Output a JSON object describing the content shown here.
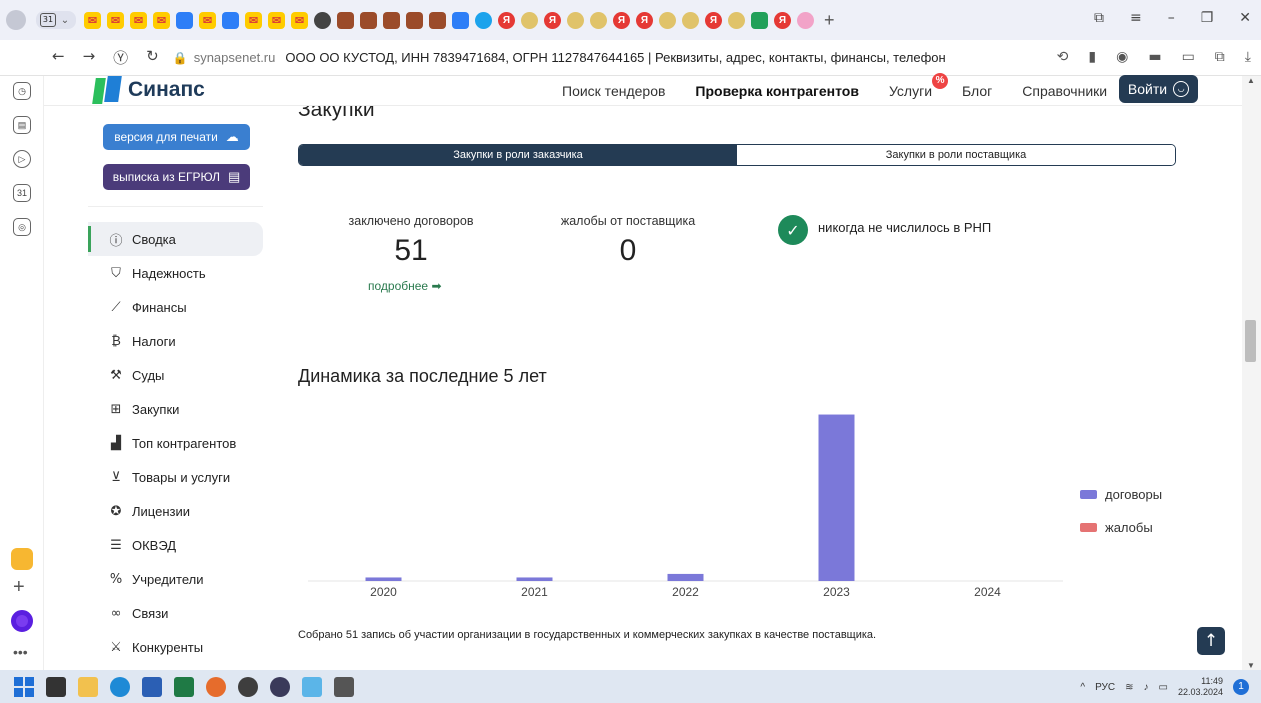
{
  "browser": {
    "calendar_badge": "31",
    "address": {
      "domain": "synapsenet.ru",
      "page_title": "ООО ОО КУСТОД, ИНН 7839471684, ОГРН 1127847644165 | Реквизиты, адрес, контакты, финансы, телефон и..."
    }
  },
  "header": {
    "logo_text": "Синапс",
    "nav": [
      {
        "label": "Поиск тендеров"
      },
      {
        "label": "Проверка контрагентов"
      },
      {
        "label": "Услуги"
      },
      {
        "label": "Блог"
      },
      {
        "label": "Справочники"
      }
    ],
    "services_badge": "%",
    "login_label": "Войти"
  },
  "sidebar": {
    "print_button": "версия для печати",
    "egrul_button": "выписка из ЕГРЮЛ",
    "items": [
      {
        "label": "Сводка",
        "icon": "info-icon"
      },
      {
        "label": "Надежность",
        "icon": "shield-icon"
      },
      {
        "label": "Финансы",
        "icon": "chart-line-icon"
      },
      {
        "label": "Налоги",
        "icon": "tax-icon"
      },
      {
        "label": "Суды",
        "icon": "gavel-icon"
      },
      {
        "label": "Закупки",
        "icon": "briefcase-icon"
      },
      {
        "label": "Топ контрагентов",
        "icon": "podium-icon"
      },
      {
        "label": "Товары и услуги",
        "icon": "cart-icon"
      },
      {
        "label": "Лицензии",
        "icon": "medal-icon"
      },
      {
        "label": "ОКВЭД",
        "icon": "list-icon"
      },
      {
        "label": "Учредители",
        "icon": "percent-icon"
      },
      {
        "label": "Связи",
        "icon": "link-icon"
      },
      {
        "label": "Конкуренты",
        "icon": "swords-icon"
      }
    ]
  },
  "main": {
    "section_title": "Закупки",
    "tabs": [
      {
        "label": "Закупки в роли заказчика"
      },
      {
        "label": "Закупки в роли поставщика"
      }
    ],
    "stats": {
      "contracts_label": "заключено договоров",
      "contracts_value": "51",
      "more_link": "подробнее ➡",
      "complaints_label": "жалобы от поставщика",
      "complaints_value": "0",
      "rnp_text": "никогда не числилось в РНП"
    },
    "chart_title": "Динамика за последние 5 лет",
    "footnote": "Собрано 51 запись об участии организации в государственных и коммерческих закупках в качестве поставщика.",
    "scroll_top_icon": "↑"
  },
  "chart_data": {
    "type": "bar",
    "categories": [
      "2020",
      "2021",
      "2022",
      "2023",
      "2024"
    ],
    "series": [
      {
        "name": "договоры",
        "values": [
          1,
          1,
          2,
          47,
          0
        ],
        "color": "#7b78d9"
      },
      {
        "name": "жалобы",
        "values": [
          0,
          0,
          0,
          0,
          0
        ],
        "color": "#e57373"
      }
    ],
    "ylim": [
      0,
      48
    ],
    "legend": "right"
  },
  "taskbar": {
    "lang": "РУС",
    "time": "11:49",
    "date": "22.03.2024",
    "notifications": "1"
  }
}
